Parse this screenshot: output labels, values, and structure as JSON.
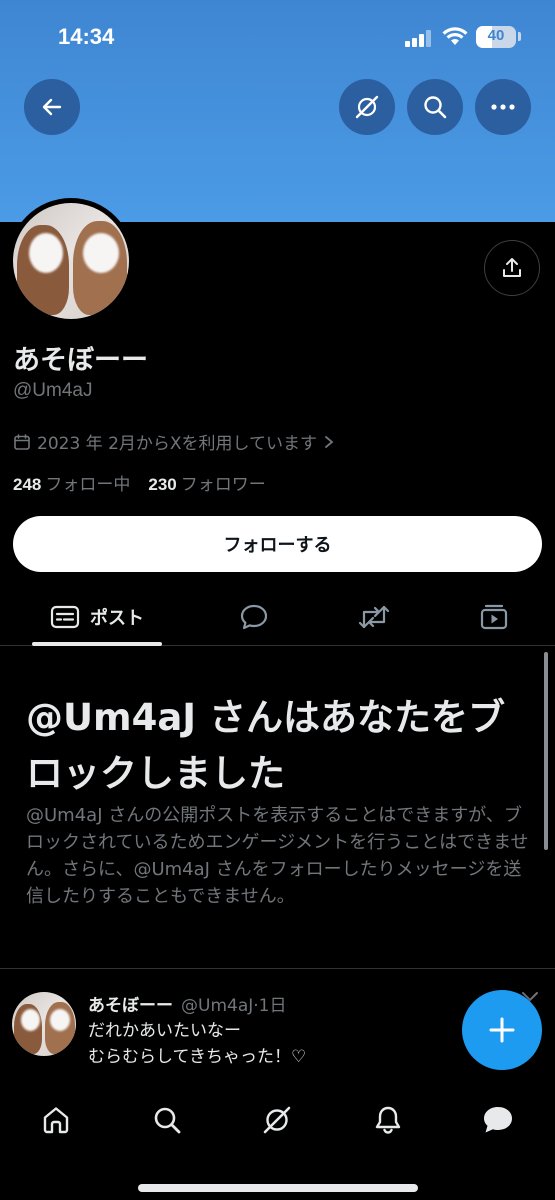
{
  "status_bar": {
    "time": "14:34",
    "battery": "40",
    "battery_level": 0.4
  },
  "header": {
    "back_icon": "arrow-left-icon",
    "grok_icon": "grok-icon",
    "search_icon": "search-icon",
    "more_icon": "more-horizontal-icon",
    "banner_color": "#4b9be6"
  },
  "profile": {
    "display_name": "あそぼーー",
    "handle": "@Um4aJ",
    "joined": "2023 年 2月からXを利用しています",
    "following_count": "248",
    "following_label": "フォロー中",
    "followers_count": "230",
    "followers_label": "フォロワー",
    "follow_button": "フォローする"
  },
  "tabs": [
    {
      "label": "ポスト",
      "icon": "posts-icon",
      "active": true
    },
    {
      "label": "",
      "icon": "reply-icon"
    },
    {
      "label": "",
      "icon": "repost-icon"
    },
    {
      "label": "",
      "icon": "media-icon"
    }
  ],
  "blocked": {
    "title": "@Um4aJ さんはあなたをブロックしました",
    "body": "@Um4aJ さんの公開ポストを表示することはできますが、ブロックされているためエンゲージメントを行うことはできません。さらに、@Um4aJ さんをフォローしたりメッセージを送信したりすることもできません。"
  },
  "tweet": {
    "name": "あそぼーー",
    "handle": "@Um4aJ",
    "time": "·1日",
    "line1": "だれかあいたいなー",
    "line2": "むらむらしてきちゃった！♡"
  },
  "fab_icon": "compose-plus-icon",
  "bottom_nav": [
    {
      "icon": "home-icon"
    },
    {
      "icon": "search-icon"
    },
    {
      "icon": "grok-icon"
    },
    {
      "icon": "notifications-icon"
    },
    {
      "icon": "messages-icon"
    }
  ],
  "colors": {
    "accent": "#1d9bf0",
    "background": "#000000",
    "secondary_text": "#71767b"
  }
}
